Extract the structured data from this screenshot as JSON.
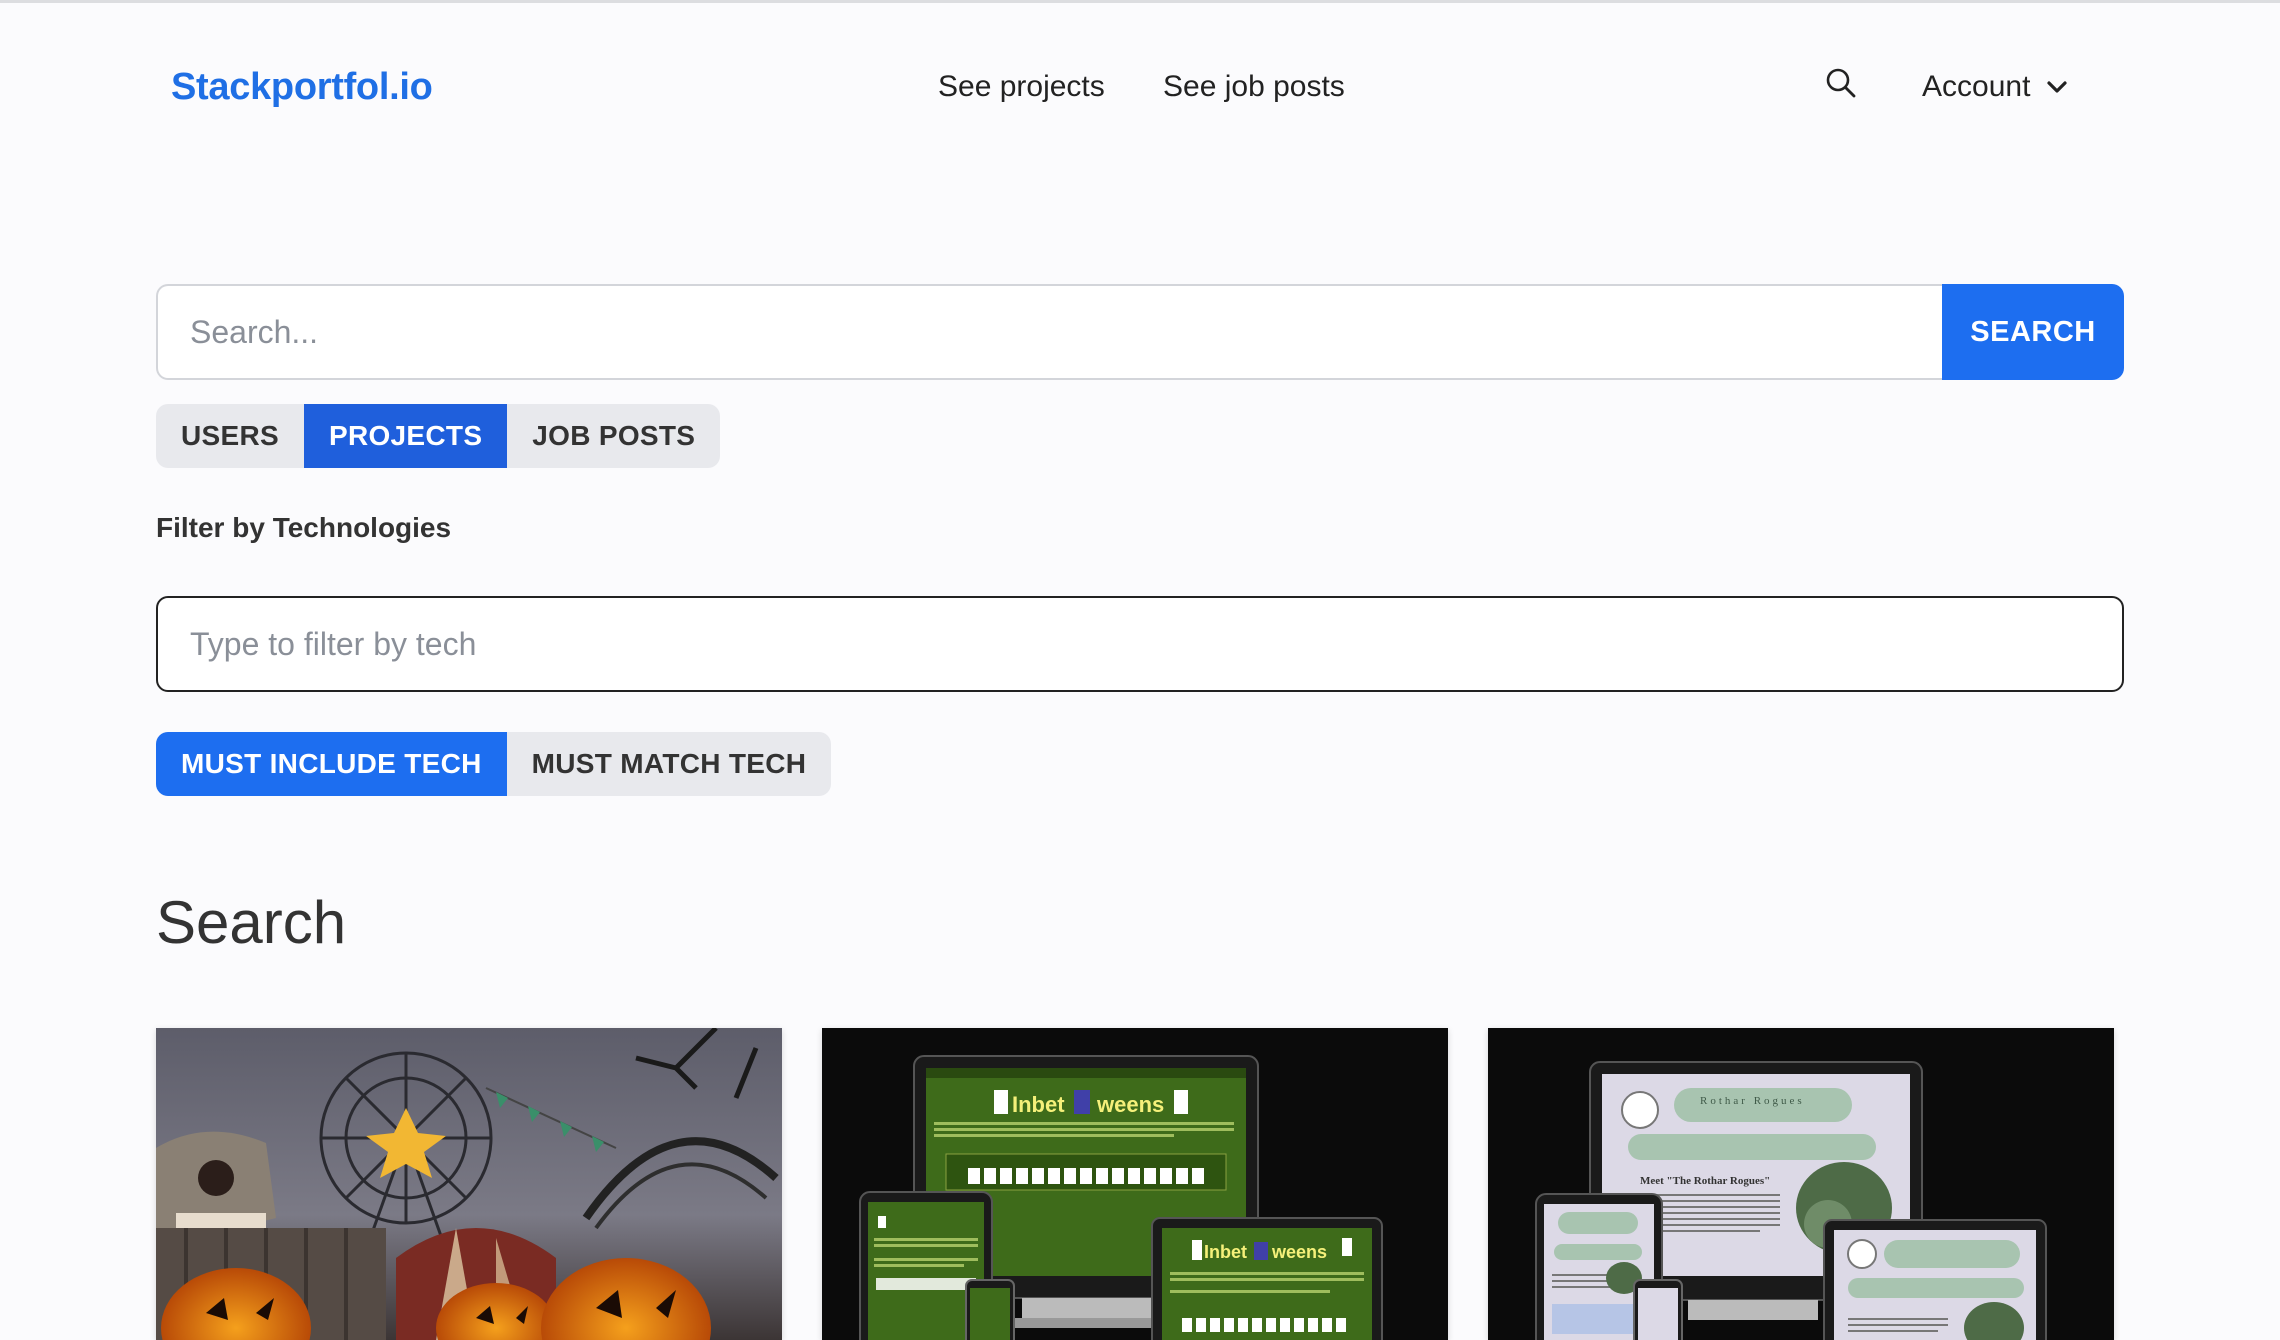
{
  "header": {
    "logo": "Stackportfol.io",
    "nav": [
      "See projects",
      "See job posts"
    ],
    "account_label": "Account"
  },
  "search": {
    "placeholder": "Search...",
    "button_label": "SEARCH"
  },
  "type_toggle": {
    "options": [
      "USERS",
      "PROJECTS",
      "JOB POSTS"
    ],
    "selected": "PROJECTS"
  },
  "filter": {
    "label": "Filter by Technologies",
    "placeholder": "Type to filter by tech"
  },
  "match_toggle": {
    "options": [
      "MUST INCLUDE TECH",
      "MUST MATCH TECH"
    ],
    "selected": "MUST INCLUDE TECH"
  },
  "results": {
    "title": "Search"
  },
  "cards": [
    {
      "image": "halloween-carnival-thumbnail"
    },
    {
      "image": "inbetweens-mockup-thumbnail",
      "screen_text": "Inbet",
      "screen_text_2": "weens"
    },
    {
      "image": "rothar-rogues-mockup-thumbnail",
      "screen_text": "Rothar Rogues",
      "screen_subtitle": "Meet \"The Rothar Rogues\""
    }
  ],
  "colors": {
    "brand": "#1f6fe5",
    "primary_button": "#1d6ef0",
    "active_tab": "#1f5fdc",
    "inactive_group_bg": "#e8e9ed",
    "page_bg": "#fbfbfd"
  }
}
